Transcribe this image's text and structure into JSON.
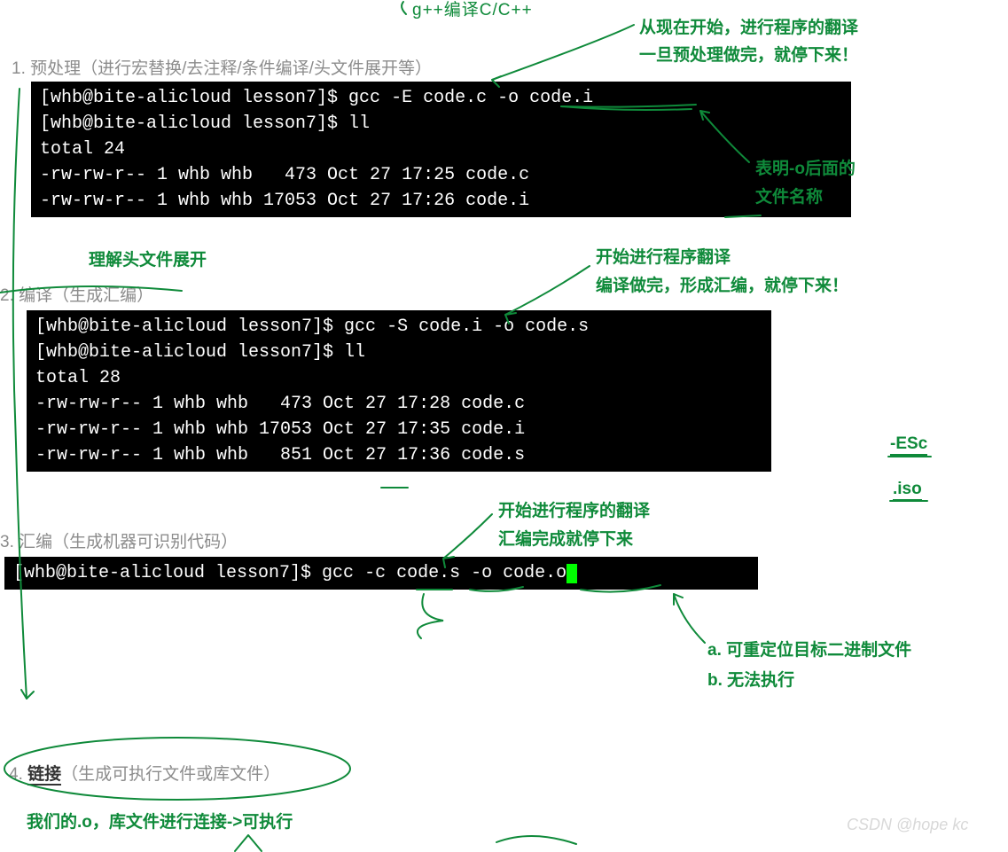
{
  "top_note": "g++编译C/C++",
  "annotations": {
    "top_right_1": "从现在开始，进行程序的翻译",
    "top_right_2": "一旦预处理做完，就停下来！",
    "note_o_arg_1": "表明-o后面的",
    "note_o_arg_2": "文件名称",
    "header_expand": "理解头文件展开",
    "compile_1": "开始进行程序翻译",
    "compile_2": "编译做完，形成汇编，就停下来！",
    "assembly_1": "开始进行程序的翻译",
    "assembly_2": "汇编完成就停下来",
    "right_esc": "-ESc",
    "right_iso": ".iso",
    "obj_a": "a. 可重定位目标二进制文件",
    "obj_b": "b. 无法执行",
    "link_note": "我们的.o，库文件进行连接->可执行"
  },
  "steps": {
    "s1": "1. 预处理（进行宏替换/去注释/条件编译/头文件展开等）",
    "s2": "2. 编译（生成汇编）",
    "s3": "3. 汇编（生成机器可识别代码）",
    "s4_num": "4. ",
    "s4_link": "链接",
    "s4_tail": "（生成可执行文件或库文件）"
  },
  "terminal1": "[whb@bite-alicloud lesson7]$ gcc -E code.c -o code.i\n[whb@bite-alicloud lesson7]$ ll\ntotal 24\n-rw-rw-r-- 1 whb whb   473 Oct 27 17:25 code.c\n-rw-rw-r-- 1 whb whb 17053 Oct 27 17:26 code.i",
  "terminal2": "[whb@bite-alicloud lesson7]$ gcc -S code.i -o code.s\n[whb@bite-alicloud lesson7]$ ll\ntotal 28\n-rw-rw-r-- 1 whb whb   473 Oct 27 17:28 code.c\n-rw-rw-r-- 1 whb whb 17053 Oct 27 17:35 code.i\n-rw-rw-r-- 1 whb whb   851 Oct 27 17:36 code.s",
  "terminal3": "[whb@bite-alicloud lesson7]$ gcc -c code.s -o code.o",
  "watermark": "CSDN @hope kc"
}
